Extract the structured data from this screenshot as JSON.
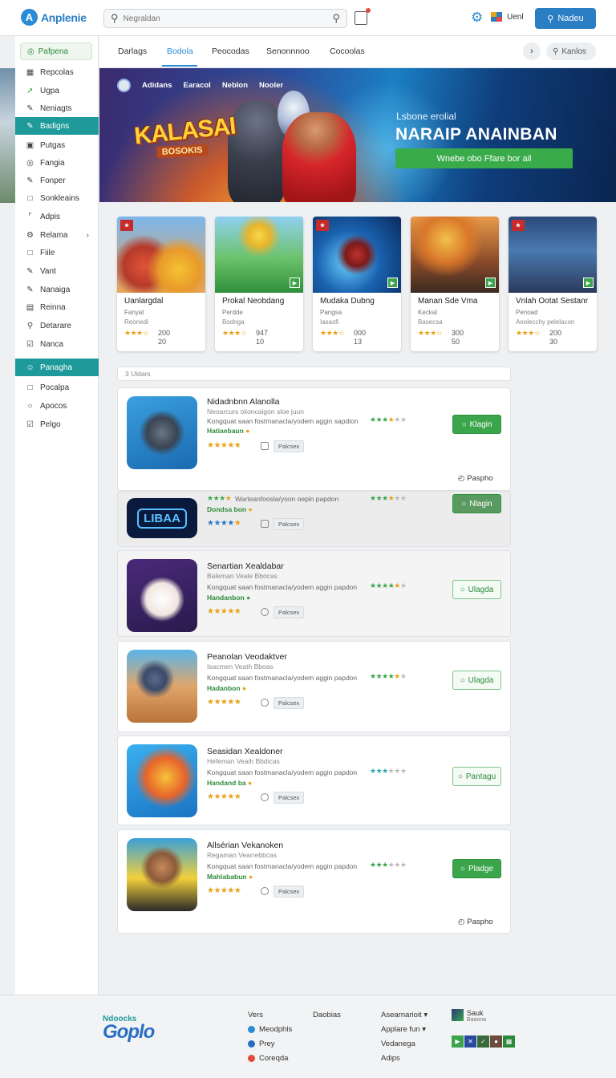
{
  "header": {
    "logo_text": "Anplenie",
    "search_placeholder": "Negraldan",
    "lang_label": "Uenl",
    "signin_label": "Nadeu"
  },
  "sidebar": {
    "top_label": "Pafpena",
    "items": [
      {
        "label": "Repcolas",
        "icon": "grid-icon"
      },
      {
        "label": "Ugpa",
        "icon": "up-arrow-icon"
      },
      {
        "label": "Neniagts",
        "icon": "pencil-icon"
      },
      {
        "label": "Badigns",
        "icon": "pencil-icon",
        "active": true
      },
      {
        "label": "Putgas",
        "icon": "square-icon"
      },
      {
        "label": "Fangia",
        "icon": "globe-icon"
      },
      {
        "label": "Fonper",
        "icon": "pencil-icon"
      },
      {
        "label": "Sonkleains",
        "icon": "square-icon"
      },
      {
        "label": "Adpis",
        "icon": "bracket-icon"
      },
      {
        "label": "Relama",
        "icon": "gear-icon",
        "chevron": true
      },
      {
        "label": "Fiile",
        "icon": "square-icon"
      },
      {
        "label": "Vant",
        "icon": "pencil-icon"
      },
      {
        "label": "Nanaiga",
        "icon": "pencil-icon"
      },
      {
        "label": "Reinna",
        "icon": "list-icon"
      },
      {
        "label": "Detarare",
        "icon": "search-icon"
      },
      {
        "label": "Nanca",
        "icon": "edit-icon"
      }
    ],
    "section_label": "Panagha",
    "bottom_items": [
      {
        "label": "Pocalpa",
        "icon": "square-icon"
      },
      {
        "label": "Apocos",
        "icon": "circle-icon"
      },
      {
        "label": "Pelgo",
        "icon": "check-icon"
      }
    ]
  },
  "tabs": {
    "items": [
      "Darlags",
      "Bodola",
      "Peocodas",
      "Senonnnoo",
      "Cocoolas"
    ],
    "active_index": 1,
    "search_label": "Kanlos"
  },
  "hero": {
    "nav": [
      "Adidans",
      "Earacol",
      "Neblon",
      "Nooler"
    ],
    "logo_line1": "KALASAI",
    "logo_line2": "BOSOKIS",
    "subtitle": "Lsbone erolial",
    "title": "NARAIP ANAINBAN",
    "cta_label": "Wnebe obo Ffare bor ail"
  },
  "featured": [
    {
      "title": "Uanlargdal",
      "sub1": "Fanyat",
      "sub2": "Reonedi",
      "stars": "★★★☆",
      "count": "200",
      "num": "20"
    },
    {
      "title": "Prokal Neobdang",
      "sub1": "Perdde",
      "sub2": "Bodnga",
      "stars": "★★★☆",
      "count": "947",
      "num": "10"
    },
    {
      "title": "Mudaka Dubng",
      "sub1": "Pangsa",
      "sub2": "Iasasfi",
      "stars": "★★★☆",
      "count": "000",
      "num": "13"
    },
    {
      "title": "Manan Sde Vma",
      "sub1": "Keckal",
      "sub2": "Basecsa",
      "stars": "★★★☆",
      "count": "300",
      "num": "50"
    },
    {
      "title": "Vnlah Ootat Sestanr",
      "sub1": "Penoad",
      "sub2": "Aeolecchy pelelacon",
      "stars": "★★★☆",
      "count": "200",
      "num": "30"
    }
  ],
  "results_count": "3 Uldars",
  "list": [
    {
      "title": "Nidadnbnn Alanolla",
      "sub": "Neoarcurs oiioncaigon sloe juun",
      "desc": "Kongquat saan fostmanacla/yodem aggin sapdion",
      "pub": "Hatiaebaun",
      "tag": "Palcsex",
      "button": "Klagin",
      "more": "Paspho",
      "rate_on": 3,
      "rate_half": 1,
      "rate_off": 2
    },
    {
      "title": "",
      "sub": "",
      "desc": "Warteanfoosla/yoon oepin papdon",
      "pub": "Dondsa bon",
      "tag": "Palcsex",
      "button": "Nlagin",
      "more": "",
      "rate_on": 3,
      "rate_half": 1,
      "rate_off": 2
    },
    {
      "title": "Senartian Xealdabar",
      "sub": "Baleman Veale Bbocas",
      "desc": "Kongquat saan fostmanacla/yodem aggin papdon",
      "pub": "Handanbon",
      "tag": "Palcsex",
      "button": "Ulagda",
      "more": "",
      "rate_on": 4,
      "rate_half": 1,
      "rate_off": 1
    },
    {
      "title": "Peanolan Veodaktver",
      "sub": "Isacmen Veath Bboas",
      "desc": "Kongquat saan fostmanacla/yodem aggin papdon",
      "pub": "Hadanbon",
      "tag": "Palcsex",
      "button": "Ulagda",
      "more": "",
      "rate_on": 4,
      "rate_half": 1,
      "rate_off": 1
    },
    {
      "title": "Seasidan Xealdoner",
      "sub": "Hefeman Veaih Bbdicas",
      "desc": "Kongquat saan fostmanacla/yodem aggin papdon",
      "pub": "Handand ba",
      "tag": "Palcsex",
      "button": "Pantagu",
      "more": "",
      "rate_on": 3,
      "rate_half": 0,
      "rate_off": 3
    },
    {
      "title": "Allsérian Vekanoken",
      "sub": "Regaman Vearrebbcas",
      "desc": "Kongquat saan fostmanacla/yodem aggin papdon",
      "pub": "Mahlababun",
      "tag": "Palcsex",
      "button": "Pladge",
      "more": "Paspho",
      "rate_on": 3,
      "rate_half": 0,
      "rate_off": 3
    }
  ],
  "footer": {
    "logo_small": "Ndoocks",
    "logo_big": "Goplo",
    "col1_head": "Vers",
    "col1": [
      "Meodphls",
      "Prey",
      "Coreqda"
    ],
    "col2_head": "Daobias",
    "col3": [
      "Asearnarioit ▾",
      "Applare fun ▾",
      "Vedanega",
      "Adips"
    ],
    "col4_title": "Sauk",
    "col4_sub": "Baaona"
  },
  "colors": {
    "accent": "#2a7ec4",
    "green": "#3aa54b",
    "teal": "#1f9a9a"
  }
}
